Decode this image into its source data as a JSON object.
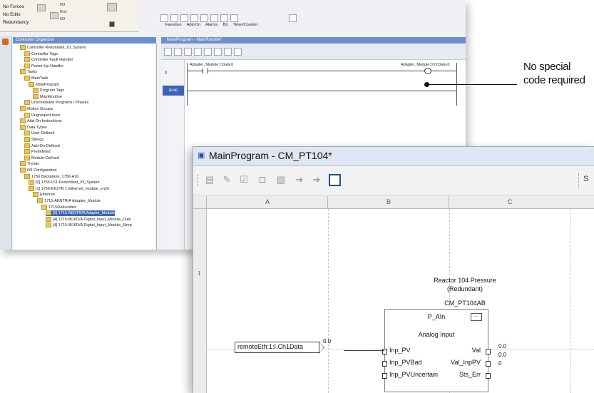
{
  "back_window": {
    "status_panel": {
      "row1": "No Forces",
      "row2": "No Edits",
      "row3": "Redundancy",
      "sub1": "I/O",
      "sub2": "Rn1",
      "sub3": "I/O"
    },
    "tabs": [
      "Favorites",
      "Add-On",
      "Alarms",
      "Bit",
      "Timer/Counter"
    ],
    "organizer_title": "Controller Organizer",
    "tree": [
      "Controller Redundant_IO_System",
      "Controller Tags",
      "Controller Fault Handler",
      "Power-Up Handler",
      "Tasks",
      "MainTask",
      "MainProgram",
      "Program Tags",
      "MainRoutine",
      "Unscheduled Programs / Phases",
      "Motion Groups",
      "Ungrouped Axes",
      "Add-On Instructions",
      "Data Types",
      "User-Defined",
      "Strings",
      "Add-On-Defined",
      "Predefined",
      "Module-Defined",
      "Trends",
      "I/O Configuration",
      "1756 Backplane, 1756-A10",
      "[0] 1756-L61 Redundant_IO_System",
      "[1] 1756-EN2TR 1 Ethernet_module_en2tr",
      "Ethernet",
      "1715-AENTR/A Adapter_Module",
      "1715Redundant",
      "[0] 1715-AENTR/A Adapter_Module",
      "[4] 1715-IB16D/A Digital_Input_Module_Dupl",
      "[4] 1715-IB16D/A Digital_Input_Module_Simp"
    ],
    "routine_title": "MainProgram - MainRoutine*",
    "rung_number": "0",
    "rung_end": "(End)",
    "contact_tag": "Adapter_Module:I:Data.0",
    "coil_tag": "Adapter_Module:0:O:Data.0"
  },
  "annotation": {
    "line1": "No special",
    "line2": "code required"
  },
  "front_window": {
    "title": "MainProgram - CM_PT104*",
    "toolbar_last": "S",
    "columns": [
      "A",
      "B",
      "C"
    ],
    "row_number": "1",
    "block": {
      "description_line1": "Reactor 104 Pressure",
      "description_line2": "(Redundant)",
      "tag": "CM_PT104AB",
      "name": "P_AIn",
      "name_button": "...",
      "description": "Analog Input",
      "inputs": [
        "Inp_PV",
        "Inp_PVBad",
        "Inp_PVUncertain"
      ],
      "outputs": [
        "Val",
        "Val_InpPV",
        "Sts_Err"
      ],
      "output_values": [
        "0.0",
        "0.0",
        "0"
      ]
    },
    "input_reference": {
      "tag": "remoteEth:1:I.Ch1Data",
      "value": "0.0"
    }
  }
}
